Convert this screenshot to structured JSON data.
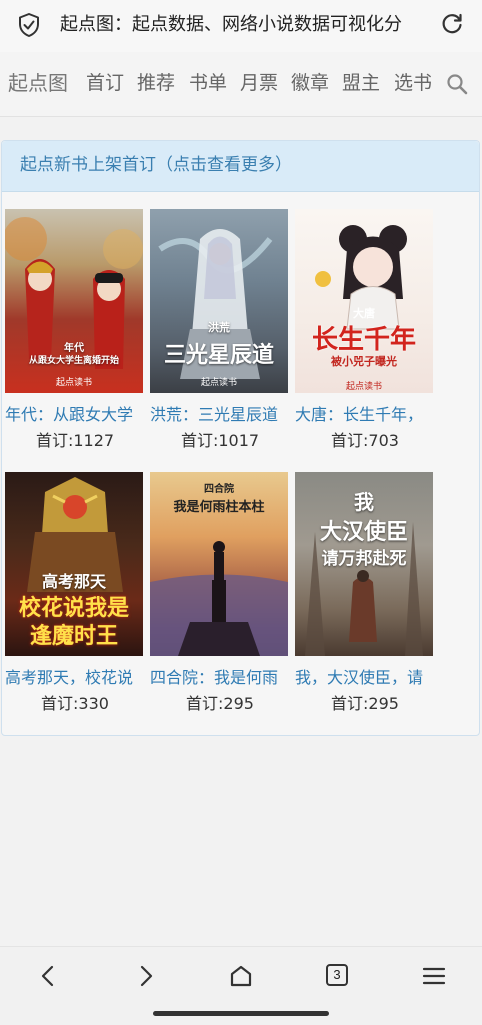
{
  "browser": {
    "title": "起点图：起点数据、网络小说数据可视化分",
    "tabs_count": "3"
  },
  "nav": {
    "home": "起点图",
    "items": [
      "首订",
      "推荐",
      "书单",
      "月票",
      "徽章",
      "盟主",
      "选书"
    ]
  },
  "panel": {
    "title": "起点新书上架首订（点击查看更多）",
    "books": [
      {
        "name": "年代：从跟女大学",
        "count": "首订:1127",
        "cover_lines": [
          "年代",
          "从跟女大学生离婚开始",
          "起点读书"
        ]
      },
      {
        "name": "洪荒：三光星辰道",
        "count": "首订:1017",
        "cover_lines": [
          "洪荒",
          "三光星辰道",
          "起点读书"
        ]
      },
      {
        "name": "大唐：长生千年，",
        "count": "首订:703",
        "cover_lines": [
          "大唐",
          "长生千年",
          "被小兕子曝光",
          "起点读书"
        ]
      },
      {
        "name": "高考那天，校花说",
        "count": "首订:330",
        "cover_lines": [
          "高考那天",
          "校花说我是",
          "逢魔时王"
        ]
      },
      {
        "name": "四合院：我是何雨",
        "count": "首订:295",
        "cover_lines": [
          "四合院",
          "我是何雨柱本柱"
        ]
      },
      {
        "name": "我，大汉使臣，请",
        "count": "首订:295",
        "cover_lines": [
          "我",
          "大汉使臣",
          "请万邦赴死"
        ]
      }
    ]
  }
}
